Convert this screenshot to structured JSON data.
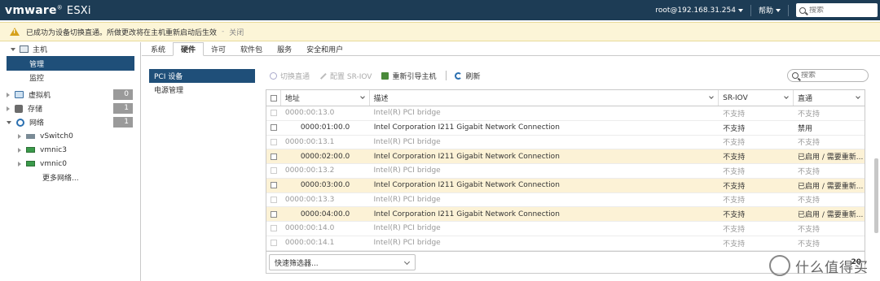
{
  "topbar": {
    "logo_brand": "vmware",
    "logo_reg": "®",
    "logo_product": "ESXi",
    "user": "root@192.168.31.254",
    "help": "帮助",
    "search_placeholder": "搜索"
  },
  "notification": {
    "message": "已成功为设备切换直通。所做更改将在主机重新启动后生效",
    "close": "关闭"
  },
  "sidebar": {
    "host": "主机",
    "manage": "管理",
    "monitor": "监控",
    "vms": {
      "label": "虚拟机",
      "count": "0"
    },
    "storage": {
      "label": "存储",
      "count": "1"
    },
    "network": {
      "label": "网络",
      "count": "1"
    },
    "net_items": [
      "vSwitch0",
      "vmnic3",
      "vmnic0"
    ],
    "more_networks": "更多网络..."
  },
  "tabs": [
    "系统",
    "硬件",
    "许可",
    "软件包",
    "服务",
    "安全和用户"
  ],
  "active_tab": "硬件",
  "subnav": [
    "PCI 设备",
    "电源管理"
  ],
  "toolbar": {
    "switch_passthrough": "切换直通",
    "configure_sriov": "配置 SR-IOV",
    "reboot_host": "重新引导主机",
    "refresh": "刷新",
    "search_placeholder": "搜索"
  },
  "grid": {
    "headers": {
      "address": "地址",
      "description": "描述",
      "sriov": "SR-IOV",
      "passthrough": "直通"
    },
    "rows": [
      {
        "address": "0000:00:13.0",
        "description": "Intel(R) PCI bridge",
        "sriov": "不支持",
        "passthrough": "不支持",
        "dim": true,
        "hi": false
      },
      {
        "address": "0000:01:00.0",
        "description": "Intel Corporation I211 Gigabit Network Connection",
        "sriov": "不支持",
        "passthrough": "禁用",
        "dim": false,
        "hi": false
      },
      {
        "address": "0000:00:13.1",
        "description": "Intel(R) PCI bridge",
        "sriov": "不支持",
        "passthrough": "不支持",
        "dim": true,
        "hi": false
      },
      {
        "address": "0000:02:00.0",
        "description": "Intel Corporation I211 Gigabit Network Connection",
        "sriov": "不支持",
        "passthrough": "已启用 / 需要重新...",
        "dim": false,
        "hi": true
      },
      {
        "address": "0000:00:13.2",
        "description": "Intel(R) PCI bridge",
        "sriov": "不支持",
        "passthrough": "不支持",
        "dim": true,
        "hi": false
      },
      {
        "address": "0000:03:00.0",
        "description": "Intel Corporation I211 Gigabit Network Connection",
        "sriov": "不支持",
        "passthrough": "已启用 / 需要重新...",
        "dim": false,
        "hi": true
      },
      {
        "address": "0000:00:13.3",
        "description": "Intel(R) PCI bridge",
        "sriov": "不支持",
        "passthrough": "不支持",
        "dim": true,
        "hi": false
      },
      {
        "address": "0000:04:00.0",
        "description": "Intel Corporation I211 Gigabit Network Connection",
        "sriov": "不支持",
        "passthrough": "已启用 / 需要重新...",
        "dim": false,
        "hi": true
      },
      {
        "address": "0000:00:14.0",
        "description": "Intel(R) PCI bridge",
        "sriov": "不支持",
        "passthrough": "不支持",
        "dim": true,
        "hi": false
      },
      {
        "address": "0000:00:14.1",
        "description": "Intel(R) PCI bridge",
        "sriov": "不支持",
        "passthrough": "不支持",
        "dim": true,
        "hi": false
      }
    ],
    "quick_filter": "快速筛选器...",
    "count": "20"
  },
  "watermark": "什么值得买"
}
